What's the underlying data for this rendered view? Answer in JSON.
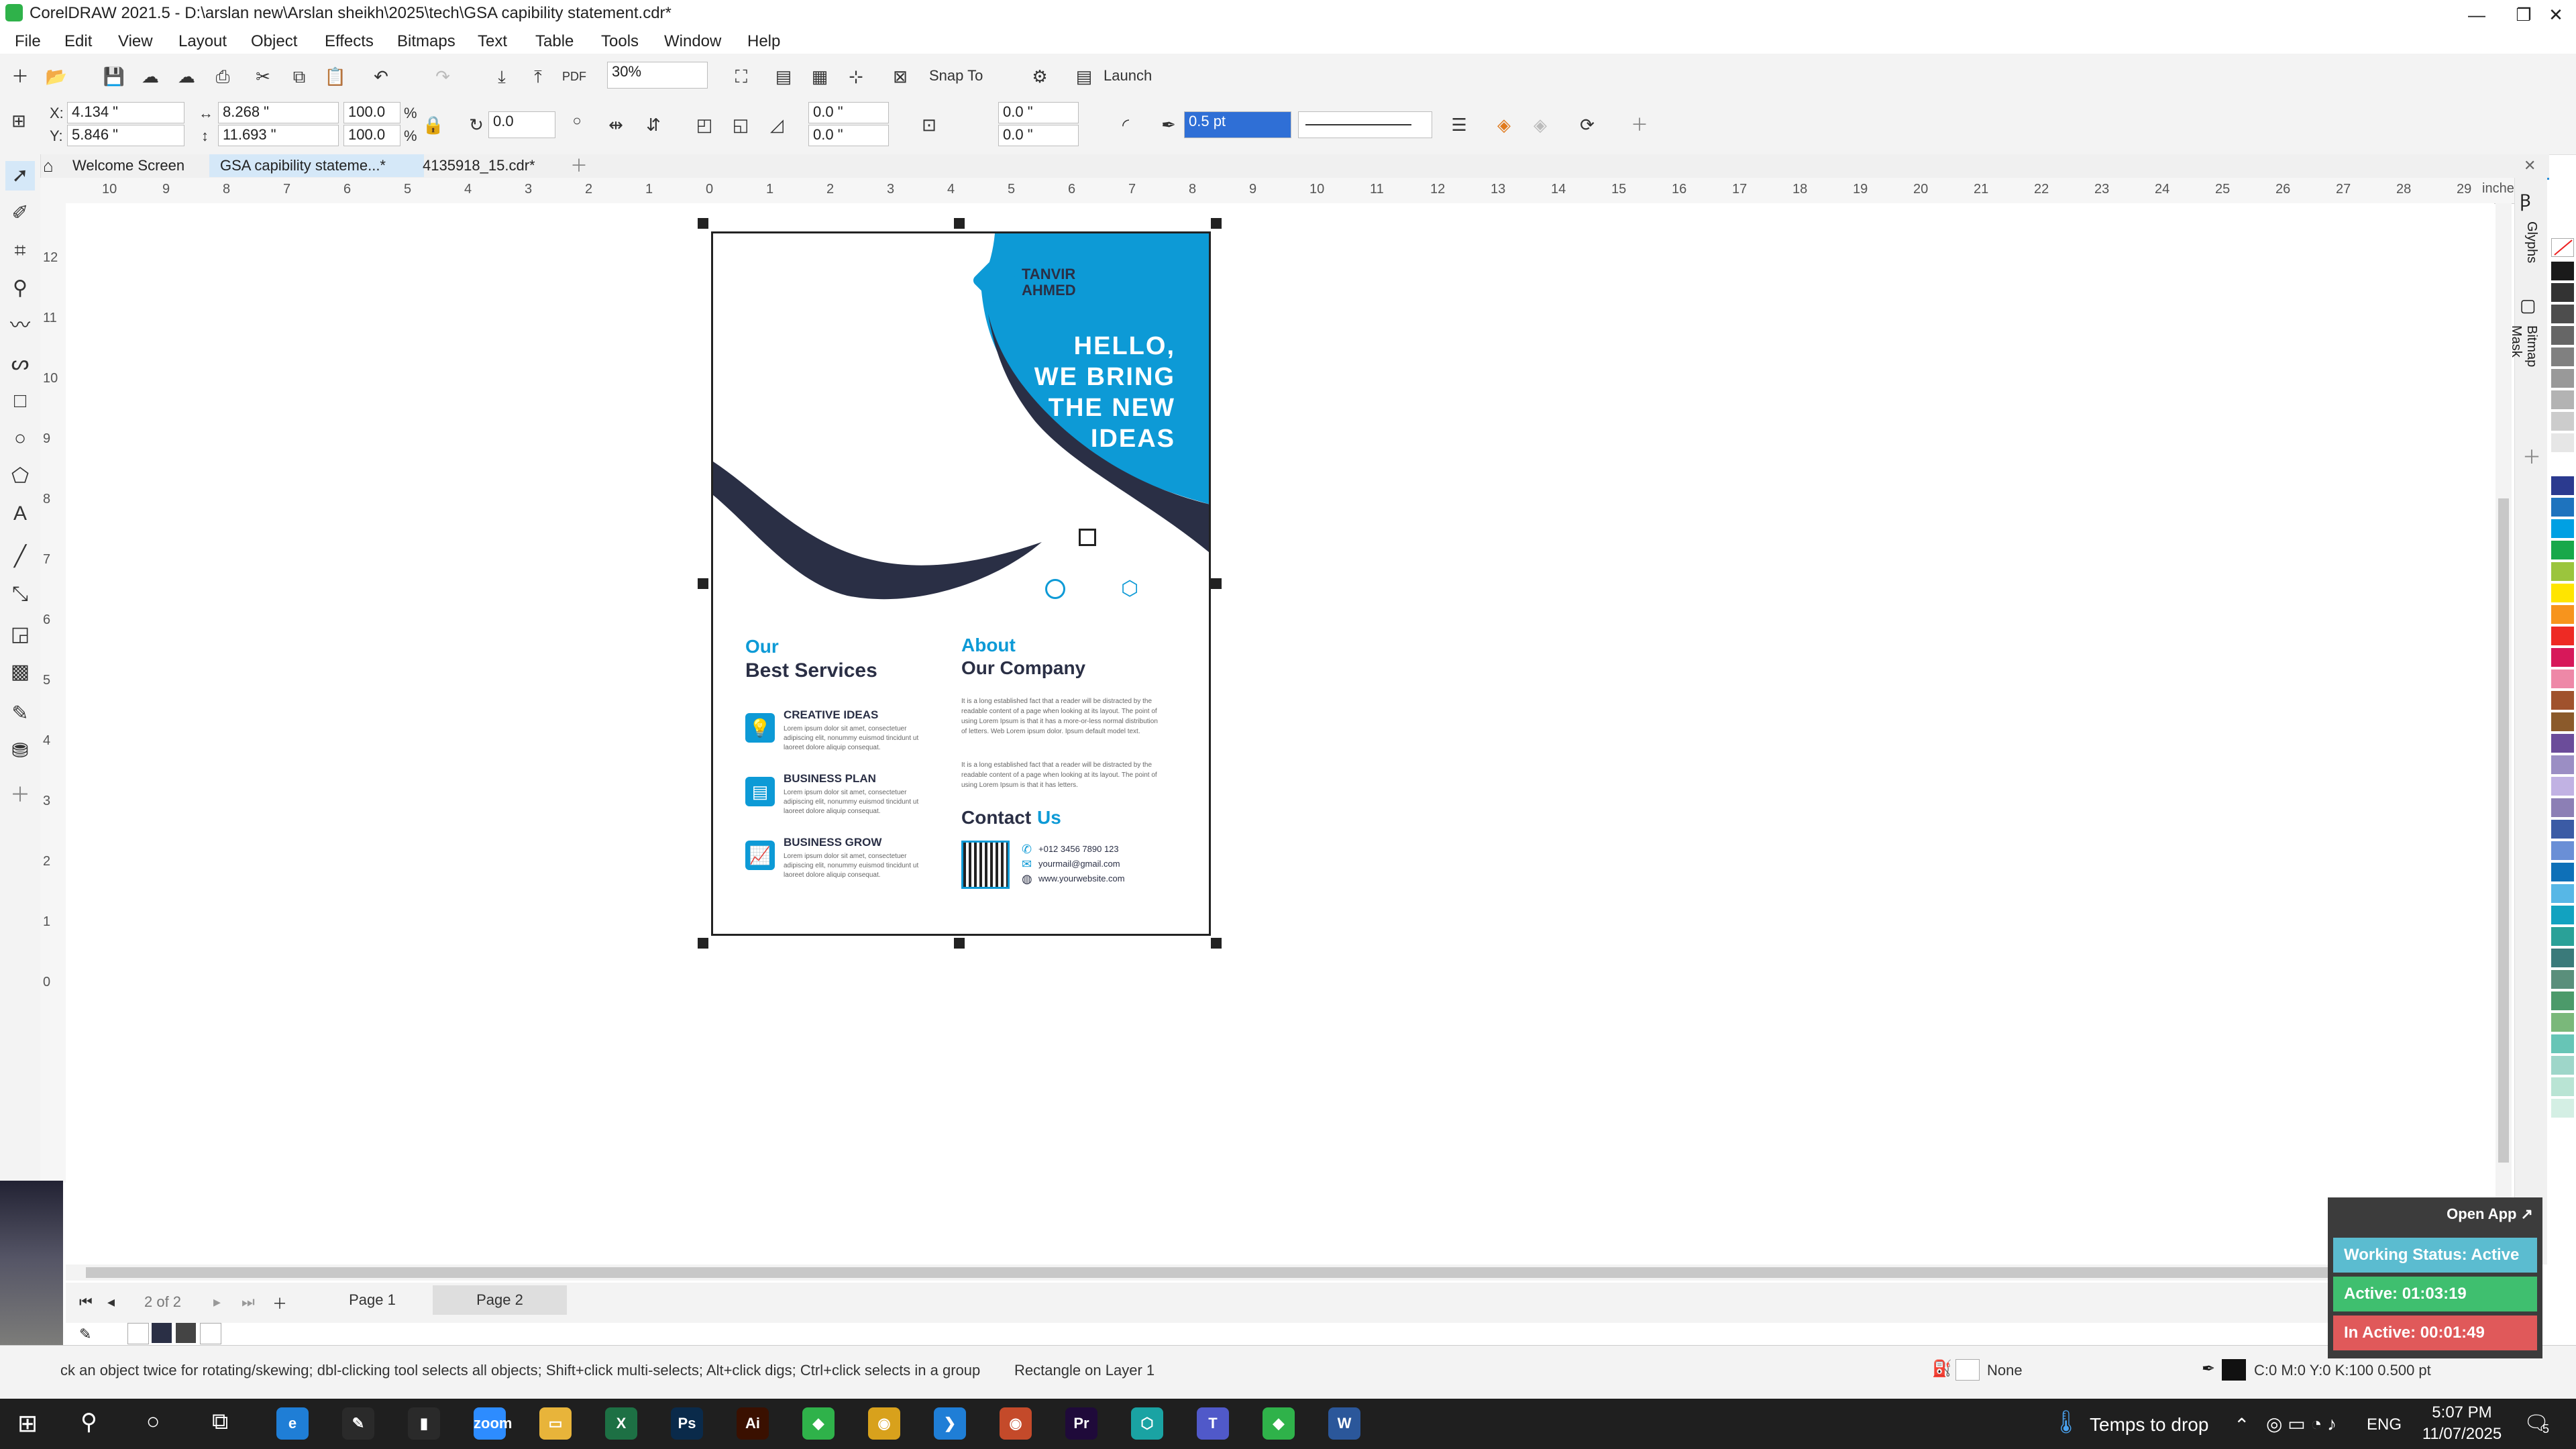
{
  "window": {
    "title": "CorelDRAW 2021.5 - D:\\arslan new\\Arslan sheikh\\2025\\tech\\GSA  capibility statement.cdr*",
    "minimize": "—",
    "maximize": "❐",
    "close": "✕"
  },
  "menu": [
    "File",
    "Edit",
    "View",
    "Layout",
    "Object",
    "Effects",
    "Bitmaps",
    "Text",
    "Table",
    "Tools",
    "Window",
    "Help"
  ],
  "standard_toolbar": {
    "zoom": "30%",
    "snap_to": "Snap To",
    "launch": "Launch"
  },
  "property_bar": {
    "x_label": "X:",
    "x": "4.134 \"",
    "y_label": "Y:",
    "y": "5.846 \"",
    "width": "8.268 \"",
    "height": "11.693 \"",
    "scale_w": "100.0",
    "scale_h": "100.0",
    "percent": "%",
    "rotation": "0.0",
    "corner_1": "0.0 \"",
    "corner_2": "0.0 \"",
    "corner_3": "0.0 \"",
    "corner_4": "0.0 \"",
    "outline_width": "0.5 pt"
  },
  "tabs": [
    {
      "label": "Welcome Screen"
    },
    {
      "label": "GSA  capibility stateme...*"
    },
    {
      "label": "4135918_15.cdr*"
    }
  ],
  "ruler": {
    "unit": "inches",
    "h_labels": [
      "10",
      "9",
      "8",
      "7",
      "6",
      "5",
      "4",
      "3",
      "2",
      "1",
      "0",
      "1",
      "2",
      "3",
      "4",
      "5",
      "6",
      "7",
      "8",
      "9",
      "10",
      "11",
      "12",
      "13",
      "14",
      "15",
      "16",
      "17",
      "18",
      "19",
      "20",
      "21",
      "22",
      "23",
      "24",
      "25",
      "26",
      "27",
      "28",
      "29"
    ],
    "v_labels": [
      "12",
      "11",
      "10",
      "9",
      "8",
      "7",
      "6",
      "5",
      "4",
      "3",
      "2",
      "1",
      "0"
    ]
  },
  "flyer": {
    "brand_line1": "TANVIR",
    "brand_line2": "AHMED",
    "headline": [
      "HELLO,",
      "WE BRING",
      "THE NEW",
      "IDEAS"
    ],
    "services_title_1": "Our",
    "services_title_2": "Best Services",
    "services": [
      {
        "title": "CREATIVE IDEAS",
        "text": "Lorem ipsum dolor sit amet, consectetuer adipiscing elit, nonummy euismod tincidunt ut laoreet dolore aliquip consequat."
      },
      {
        "title": "BUSINESS PLAN",
        "text": "Lorem ipsum dolor sit amet, consectetuer adipiscing elit, nonummy euismod tincidunt ut laoreet dolore aliquip consequat."
      },
      {
        "title": "BUSINESS GROW",
        "text": "Lorem ipsum dolor sit amet, consectetuer adipiscing elit, nonummy euismod tincidunt ut laoreet dolore aliquip consequat."
      }
    ],
    "about_title_1": "About",
    "about_title_2": "Our Company",
    "about_p1": "It is a long established fact that a reader will be distracted by the readable content of a page when looking at its layout. The point of using Lorem Ipsum is that it has a more-or-less normal distribution of letters. Web Lorem ipsum dolor. Ipsum default model text.",
    "about_p2": "It is a long established fact that a reader will be distracted by the readable content of a page when looking at its layout. The point of using Lorem Ipsum is that it has letters.",
    "contact_title_1": "Contact",
    "contact_title_2": "Us",
    "phone": "+012 3456 7890 123",
    "email": "yourmail@gmail.com",
    "website": "www.yourwebsite.com"
  },
  "right_dockers": {
    "glyphs": "Glyphs",
    "bitmap_mask": "Bitmap Mask"
  },
  "palette": [
    "#1a1a1a",
    "#333333",
    "#4d4d4d",
    "#666666",
    "#808080",
    "#999999",
    "#b3b3b3",
    "#cccccc",
    "#e6e6e6",
    "#ffffff",
    "#2b3a8f",
    "#1e73be",
    "#00a0e3",
    "#18a84a",
    "#9bc53d",
    "#ffe500",
    "#f7941d",
    "#ee2a24",
    "#d7185a",
    "#ee88a7",
    "#a0522d",
    "#8b5a2b",
    "#6b4c9a",
    "#9b8ec4",
    "#c1b2e3",
    "#8c7fb5",
    "#3b5ba5",
    "#6a8fd6",
    "#0e70b8",
    "#57b7e6",
    "#12a2c0",
    "#2aa198",
    "#3a7a7a",
    "#5a8f7b",
    "#4c9a6a",
    "#7ab87a",
    "#67c5b6",
    "#9ed6c9",
    "#b9e4d4",
    "#d4efe4"
  ],
  "page_nav": {
    "position": "2 of 2",
    "pages": [
      "Page 1",
      "Page 2"
    ]
  },
  "status": {
    "hint": "ck an object twice for rotating/skewing; dbl-clicking tool selects all objects; Shift+click multi-selects; Alt+click digs; Ctrl+click selects in a group",
    "object": "Rectangle on Layer 1",
    "fill": "None",
    "outline": "C:0 M:0 Y:0 K:100  0.500 pt"
  },
  "widget": {
    "open_app": "Open App ↗",
    "working": "Working Status: Active",
    "active": "Active: 01:03:19",
    "inactive": "In Active: 00:01:49",
    "colors": {
      "working": "#5bbcd0",
      "active": "#3fbf6f",
      "inactive": "#e0595a"
    }
  },
  "taskbar": {
    "apps": [
      {
        "name": "edge",
        "label": "e",
        "color": "#1f7ed6"
      },
      {
        "name": "pen",
        "label": "✎",
        "color": "#2a2a2a"
      },
      {
        "name": "terminal",
        "label": "▮",
        "color": "#2a2a2a"
      },
      {
        "name": "zoom",
        "label": "zoom",
        "color": "#2d8cff"
      },
      {
        "name": "explorer",
        "label": "▭",
        "color": "#e8b43a"
      },
      {
        "name": "excel",
        "label": "X",
        "color": "#1d7044"
      },
      {
        "name": "photoshop",
        "label": "Ps",
        "color": "#0a2a4a"
      },
      {
        "name": "illustrator",
        "label": "Ai",
        "color": "#3a1000"
      },
      {
        "name": "coreldraw",
        "label": "◆",
        "color": "#2fb24a"
      },
      {
        "name": "chrome",
        "label": "◉",
        "color": "#d8a11c"
      },
      {
        "name": "vscode",
        "label": "❯",
        "color": "#1f7ed6"
      },
      {
        "name": "chrome2",
        "label": "◉",
        "color": "#c44a2a"
      },
      {
        "name": "premiere",
        "label": "Pr",
        "color": "#1f0a3a"
      },
      {
        "name": "app",
        "label": "⬡",
        "color": "#1aa3a3"
      },
      {
        "name": "teams",
        "label": "T",
        "color": "#5059c9"
      },
      {
        "name": "coreldraw2",
        "label": "◆",
        "color": "#2fb24a"
      },
      {
        "name": "word",
        "label": "W",
        "color": "#2b579a"
      }
    ],
    "weather": "Temps to drop",
    "lang": "ENG",
    "time": "5:07 PM",
    "date": "11/07/2025",
    "notif_count": "5"
  }
}
